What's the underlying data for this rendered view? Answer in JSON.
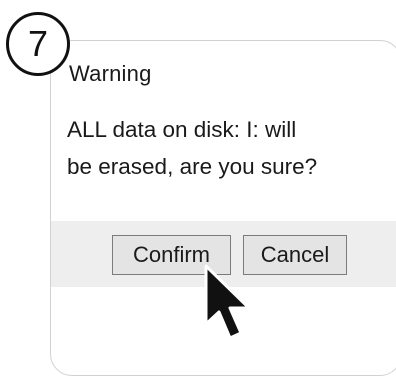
{
  "step_badge": "7",
  "dialog": {
    "title": "Warning",
    "message": "ALL data on disk: I: will\nbe erased, are you sure?",
    "buttons": {
      "confirm": "Confirm",
      "cancel": "Cancel"
    }
  },
  "cursor_icon": "arrow-pointer-icon"
}
